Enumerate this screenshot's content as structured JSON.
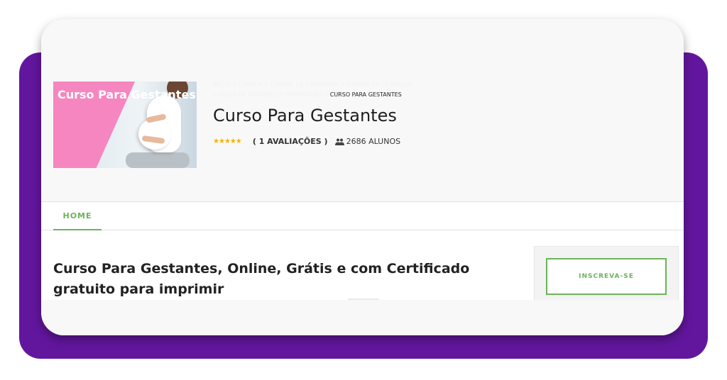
{
  "course": {
    "thumbnail_title": "Curso Para Gestantes",
    "breadcrumb": {
      "items": [
        "INÍCIO",
        "CURSOS",
        "CURSOS DA CATEGORIA",
        "CURSOS DE GESTAÇÃO",
        "CURSOS DE GRAVIDEZ E PREPARAÇÃO"
      ],
      "current": "CURSO PARA GESTANTES"
    },
    "title": "Curso Para Gestantes",
    "rating_stars": 5,
    "reviews_label": "( 1 AVALIAÇÕES )",
    "students_label": "2686 ALUNOS"
  },
  "tabs": [
    {
      "label": "HOME",
      "active": true
    }
  ],
  "main": {
    "heading": "Curso Para Gestantes, Online, Grátis e com Certificado gratuito para imprimir"
  },
  "sidebar": {
    "enroll_label": "INSCREVA-SE"
  },
  "colors": {
    "accent_green": "#6db35a",
    "frame_purple": "#62169e",
    "thumbnail_pink": "#f686c0",
    "star_gold": "#f4b400"
  },
  "icons": {
    "users": "users-icon",
    "star": "star-icon"
  }
}
